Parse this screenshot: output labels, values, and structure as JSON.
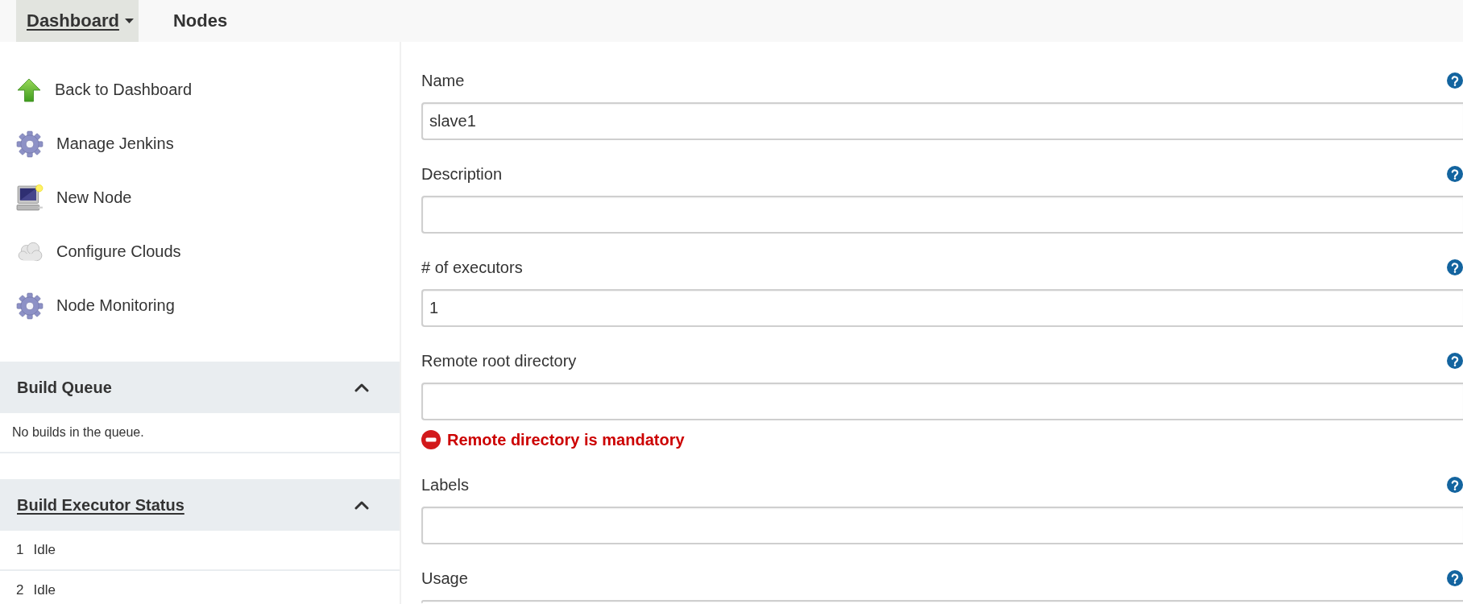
{
  "breadcrumbs": [
    {
      "label": "Dashboard",
      "selected": true,
      "menu": true
    },
    {
      "label": "Nodes",
      "selected": false,
      "menu": false
    }
  ],
  "sidebar": {
    "items": [
      {
        "label": "Back to Dashboard",
        "kind": "arrow"
      },
      {
        "label": "Manage Jenkins",
        "kind": "gear"
      },
      {
        "label": "New Node",
        "kind": "computer"
      },
      {
        "label": "Configure Clouds",
        "kind": "cloud"
      },
      {
        "label": "Node Monitoring",
        "kind": "gear"
      }
    ],
    "panels": [
      {
        "title": "Build Queue",
        "link": false,
        "expanded": true,
        "rows": [
          {
            "kind": "message",
            "text": "No builds in the queue."
          }
        ]
      },
      {
        "title": "Build Executor Status",
        "link": true,
        "expanded": true,
        "rows": [
          {
            "kind": "executor",
            "number": "1",
            "status": "Idle"
          },
          {
            "kind": "executor",
            "number": "2",
            "status": "Idle"
          }
        ]
      }
    ]
  },
  "form": {
    "fields": [
      {
        "label": "Name",
        "value": "slave1",
        "help": true
      },
      {
        "label": "Description",
        "help": true
      },
      {
        "label": "# of executors",
        "value": "1",
        "help": true
      },
      {
        "label": "Remote root directory",
        "help": true,
        "error": "Remote directory is mandatory"
      },
      {
        "label": "Labels",
        "help": true
      },
      {
        "label": "Usage",
        "help": true
      }
    ]
  }
}
